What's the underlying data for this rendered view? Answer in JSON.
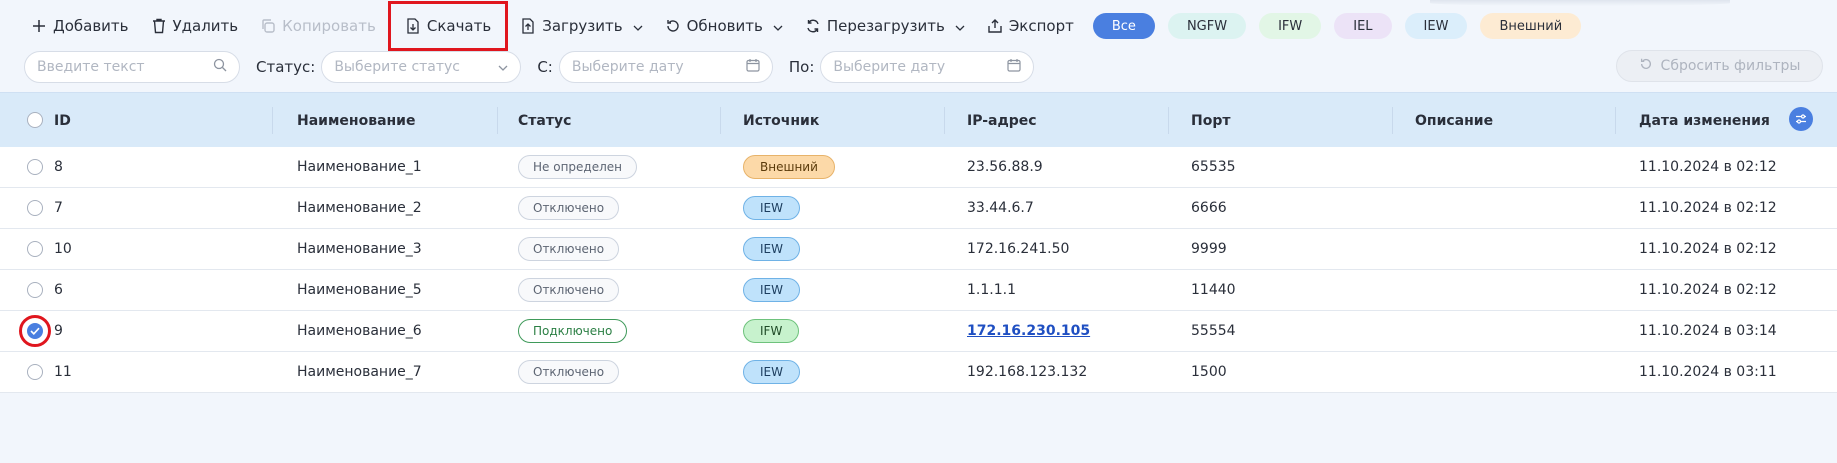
{
  "toolbar": {
    "add_label": "Добавить",
    "delete_label": "Удалить",
    "copy_label": "Копировать",
    "download_label": "Скачать",
    "upload_label": "Загрузить",
    "refresh_label": "Обновить",
    "reload_label": "Перезагрузить",
    "export_label": "Экспорт"
  },
  "chips": [
    {
      "label": "Все",
      "bg": "#4a7fe0",
      "fg": "#ffffff",
      "active": true
    },
    {
      "label": "NGFW",
      "bg": "#dcf3f1",
      "fg": "#2a2f3a"
    },
    {
      "label": "IFW",
      "bg": "#e2f6e6",
      "fg": "#2a2f3a"
    },
    {
      "label": "IEL",
      "bg": "#ece3f7",
      "fg": "#2a2f3a"
    },
    {
      "label": "IEW",
      "bg": "#dbeefb",
      "fg": "#2a2f3a"
    },
    {
      "label": "Внешний",
      "bg": "#fdebd3",
      "fg": "#2a2f3a"
    }
  ],
  "filters": {
    "search_placeholder": "Введите текст",
    "status_label": "Статус:",
    "status_placeholder": "Выберите статус",
    "from_label": "С:",
    "from_placeholder": "Выберите дату",
    "to_label": "По:",
    "to_placeholder": "Выберите дату",
    "reset_label": "Сбросить фильтры"
  },
  "table": {
    "columns": [
      "ID",
      "Наименование",
      "Статус",
      "Источник",
      "IP-адрес",
      "Порт",
      "Описание",
      "Дата изменения"
    ],
    "rows": [
      {
        "id": "8",
        "name": "Наименование_1",
        "status": "Не определен",
        "status_on": false,
        "source": "Внешний",
        "ip": "23.56.88.9",
        "port": "65535",
        "desc": "",
        "date": "11.10.2024 в 02:12",
        "checked": false
      },
      {
        "id": "7",
        "name": "Наименование_2",
        "status": "Отключено",
        "status_on": false,
        "source": "IEW",
        "ip": "33.44.6.7",
        "port": "6666",
        "desc": "",
        "date": "11.10.2024 в 02:12",
        "checked": false
      },
      {
        "id": "10",
        "name": "Наименование_3",
        "status": "Отключено",
        "status_on": false,
        "source": "IEW",
        "ip": "172.16.241.50",
        "port": "9999",
        "desc": "",
        "date": "11.10.2024 в 02:12",
        "checked": false
      },
      {
        "id": "6",
        "name": "Наименование_5",
        "status": "Отключено",
        "status_on": false,
        "source": "IEW",
        "ip": "1.1.1.1",
        "port": "11440",
        "desc": "",
        "date": "11.10.2024 в 02:12",
        "checked": false
      },
      {
        "id": "9",
        "name": "Наименование_6",
        "status": "Подключено",
        "status_on": true,
        "source": "IFW",
        "ip": "172.16.230.105",
        "port": "55554",
        "desc": "",
        "date": "11.10.2024 в 03:14",
        "checked": true,
        "ip_link": true
      },
      {
        "id": "11",
        "name": "Наименование_7",
        "status": "Отключено",
        "status_on": false,
        "source": "IEW",
        "ip": "192.168.123.132",
        "port": "1500",
        "desc": "",
        "date": "11.10.2024 в 03:11",
        "checked": false
      }
    ]
  },
  "source_colors": {
    "Внешний": {
      "bg": "#fcd9a8",
      "border": "#e7b36a",
      "fg": "#5a3a0a"
    },
    "IEW": {
      "bg": "#bfe2fb",
      "border": "#6fb2e6",
      "fg": "#1c3d5e"
    },
    "IFW": {
      "bg": "#c7f2cd",
      "border": "#6ec27c",
      "fg": "#1f4a27"
    }
  },
  "colors": {
    "accent": "#4a7fe0",
    "highlight": "#e0161e",
    "header_bg": "#d9eaf9"
  }
}
